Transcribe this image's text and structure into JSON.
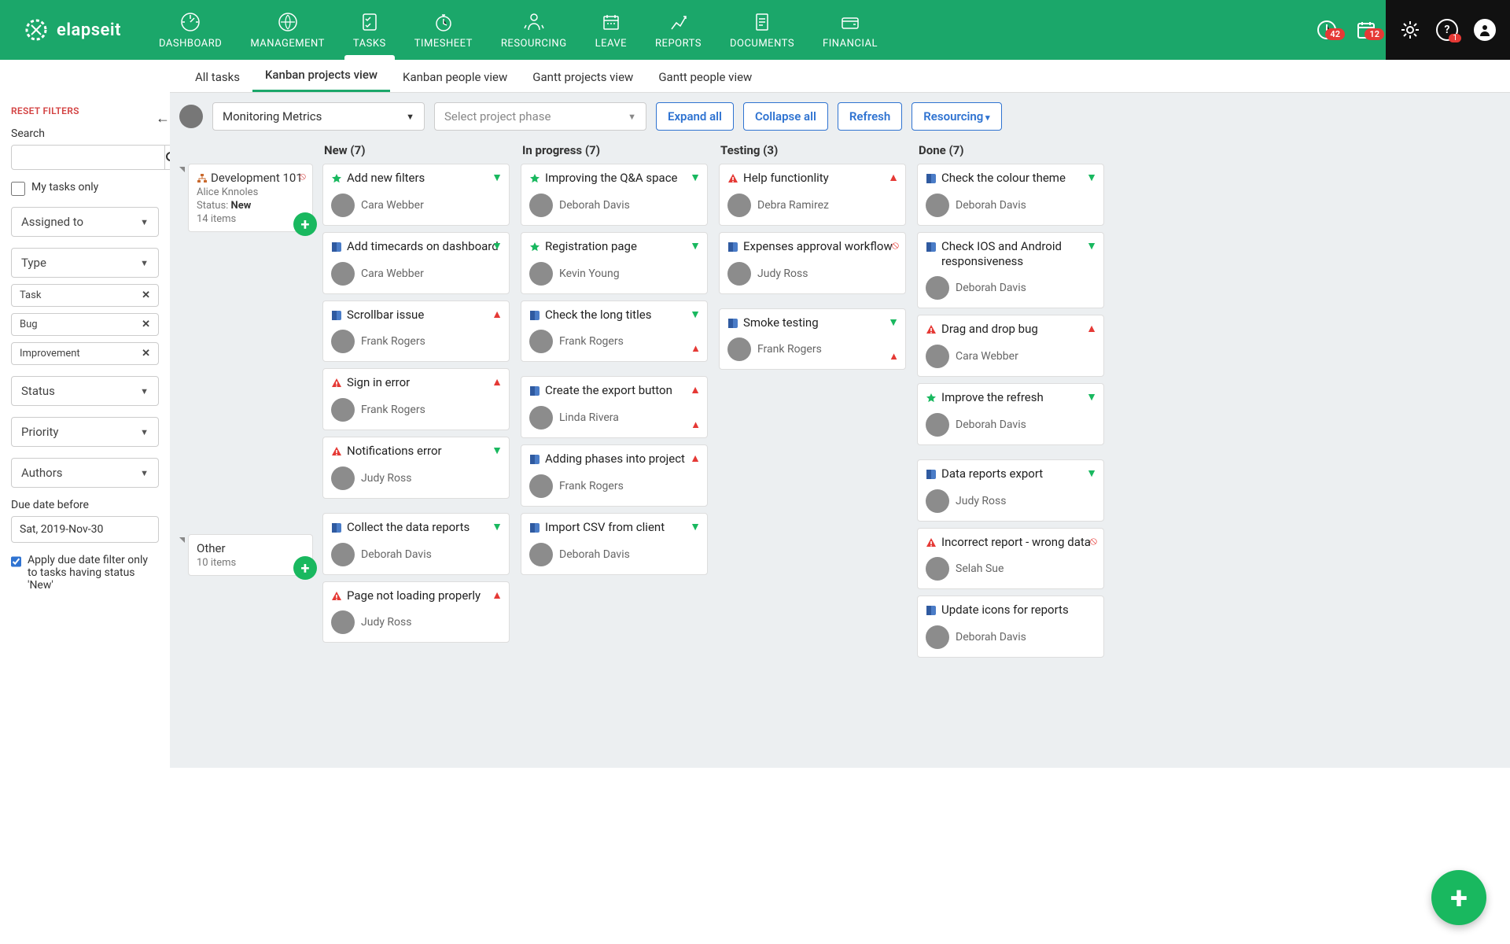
{
  "brand": "elapseit",
  "nav": {
    "items": [
      "DASHBOARD",
      "MANAGEMENT",
      "TASKS",
      "TIMESHEET",
      "RESOURCING",
      "LEAVE",
      "REPORTS",
      "DOCUMENTS",
      "FINANCIAL"
    ],
    "active": "TASKS",
    "badge_clock": "42",
    "badge_cal": "12",
    "badge_help": "1"
  },
  "subnav": {
    "tabs": [
      "All tasks",
      "Kanban projects view",
      "Kanban people view",
      "Gantt projects view",
      "Gantt people view"
    ],
    "active": "Kanban projects view"
  },
  "toolbar": {
    "project": "Monitoring Metrics",
    "phase_placeholder": "Select project phase",
    "expand": "Expand all",
    "collapse": "Collapse all",
    "refresh": "Refresh",
    "resourcing": "Resourcing"
  },
  "filters": {
    "reset": "RESET FILTERS",
    "search_label": "Search",
    "my_tasks": "My tasks only",
    "assigned": "Assigned to",
    "type": "Type",
    "type_chips": [
      "Task",
      "Bug",
      "Improvement"
    ],
    "status": "Status",
    "priority": "Priority",
    "authors": "Authors",
    "due_label": "Due date before",
    "due_value": "Sat, 2019-Nov-30",
    "apply_due": "Apply due date filter only to tasks having status 'New'"
  },
  "columns": [
    "New (7)",
    "In progress (7)",
    "Testing (3)",
    "Done (7)"
  ],
  "groups": [
    {
      "proj": {
        "title": "Development 101",
        "owner": "Alice Knnoles",
        "status_lbl": "Status: ",
        "status_val": "New",
        "items": "14 items",
        "err": true,
        "hier": true
      },
      "cols": [
        [
          {
            "type": "star",
            "t": "Add new filters",
            "p": "down",
            "a": "Cara Webber"
          },
          {
            "type": "task",
            "t": "Add timecards on dashboard",
            "p": "down",
            "a": "Cara Webber"
          },
          {
            "type": "task",
            "t": "Scrollbar issue",
            "p": "up",
            "a": "Frank Rogers"
          },
          {
            "type": "bug",
            "t": "Sign in error",
            "p": "up",
            "a": "Frank Rogers"
          },
          {
            "type": "bug",
            "t": "Notifications error",
            "p": "down",
            "a": "Judy Ross"
          }
        ],
        [
          {
            "type": "star",
            "t": "Improving the Q&A space",
            "p": "down",
            "a": "Deborah Davis"
          },
          {
            "type": "star",
            "t": "Registration page",
            "p": "down",
            "a": "Kevin Young"
          },
          {
            "type": "task",
            "t": "Check the long titles",
            "p": "down",
            "a": "Frank Rogers",
            "warn": true
          }
        ],
        [
          {
            "type": "bug",
            "t": "Help functionlity",
            "p": "up",
            "a": "Debra Ramirez"
          },
          {
            "type": "task",
            "t": "Expenses approval workflow",
            "p": "err",
            "a": "Judy Ross"
          }
        ],
        [
          {
            "type": "task",
            "t": "Check the colour theme",
            "p": "down",
            "a": "Deborah Davis"
          },
          {
            "type": "task",
            "t": "Check IOS and Android responsiveness",
            "p": "down",
            "a": "Deborah Davis"
          },
          {
            "type": "bug",
            "t": "Drag and drop bug",
            "p": "up",
            "a": "Cara Webber"
          },
          {
            "type": "star",
            "t": "Improve the refresh",
            "p": "down",
            "a": "Deborah Davis"
          }
        ]
      ]
    },
    {
      "proj": {
        "title": "Other",
        "items": "10 items"
      },
      "cols": [
        [
          {
            "type": "task",
            "t": "Collect the data reports",
            "p": "down",
            "a": "Deborah Davis"
          },
          {
            "type": "bug",
            "t": "Page not loading properly",
            "p": "up",
            "a": "Judy Ross"
          }
        ],
        [
          {
            "type": "task",
            "t": "Create the export button",
            "p": "up",
            "a": "Linda Rivera",
            "warn": true
          },
          {
            "type": "task",
            "t": "Adding phases into project",
            "p": "up",
            "a": "Frank Rogers"
          },
          {
            "type": "task",
            "t": "Import CSV from client",
            "p": "down",
            "a": "Deborah Davis"
          }
        ],
        [
          {
            "type": "task",
            "t": "Smoke testing",
            "p": "down",
            "a": "Frank Rogers",
            "warn": true
          }
        ],
        [
          {
            "type": "task",
            "t": "Data reports export",
            "p": "down",
            "a": "Judy Ross"
          },
          {
            "type": "bug",
            "t": "Incorrect report - wrong data",
            "p": "err",
            "a": "Selah Sue"
          },
          {
            "type": "task",
            "t": "Update icons for reports",
            "p": "",
            "a": "Deborah Davis"
          }
        ]
      ]
    }
  ]
}
